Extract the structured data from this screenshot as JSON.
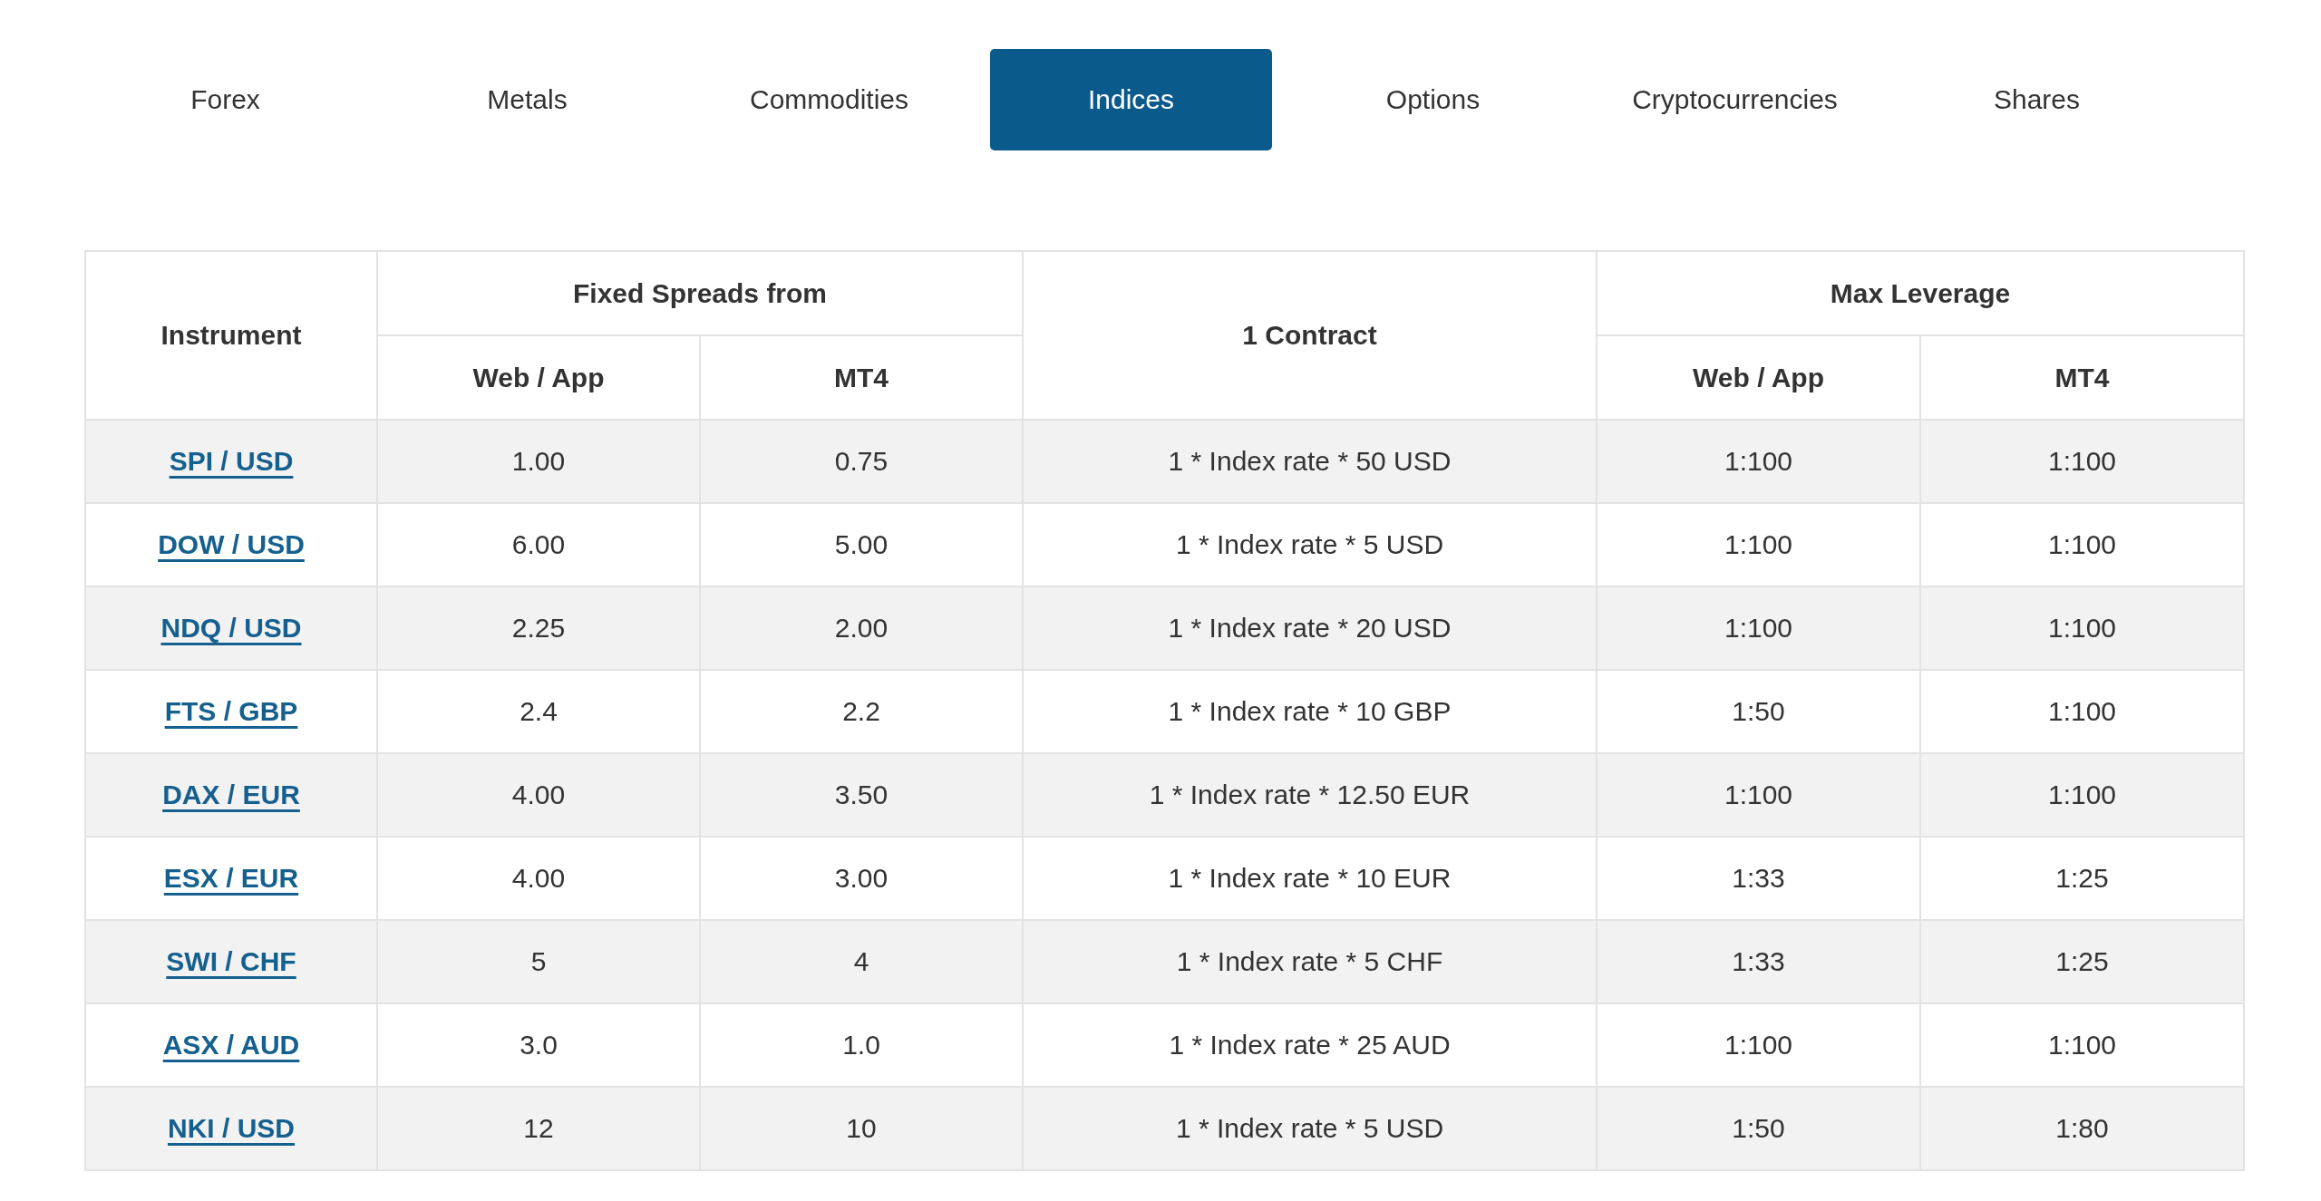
{
  "tabs": [
    {
      "label": "Forex",
      "selected": false
    },
    {
      "label": "Metals",
      "selected": false
    },
    {
      "label": "Commodities",
      "selected": false
    },
    {
      "label": "Indices",
      "selected": true
    },
    {
      "label": "Options",
      "selected": false
    },
    {
      "label": "Cryptocurrencies",
      "selected": false
    },
    {
      "label": "Shares",
      "selected": false
    }
  ],
  "table": {
    "header": {
      "instrument": "Instrument",
      "fixed_spreads": {
        "label": "Fixed Spreads from",
        "subcolumns": [
          "Web / App",
          "MT4"
        ]
      },
      "contract": "1 Contract",
      "max_leverage": {
        "label": "Max Leverage",
        "subcolumns": [
          "Web / App",
          "MT4"
        ]
      }
    },
    "rows": [
      {
        "instrument": "SPI / USD",
        "spread_web": "1.00",
        "spread_mt4": "0.75",
        "contract": "1 * Index rate * 50 USD",
        "leverage_web": "1:100",
        "leverage_mt4": "1:100"
      },
      {
        "instrument": "DOW / USD",
        "spread_web": "6.00",
        "spread_mt4": "5.00",
        "contract": "1 * Index rate * 5 USD",
        "leverage_web": "1:100",
        "leverage_mt4": "1:100"
      },
      {
        "instrument": "NDQ / USD",
        "spread_web": "2.25",
        "spread_mt4": "2.00",
        "contract": "1 * Index rate * 20 USD",
        "leverage_web": "1:100",
        "leverage_mt4": "1:100"
      },
      {
        "instrument": "FTS / GBP",
        "spread_web": "2.4",
        "spread_mt4": "2.2",
        "contract": "1 * Index rate * 10 GBP",
        "leverage_web": "1:50",
        "leverage_mt4": "1:100"
      },
      {
        "instrument": "DAX / EUR",
        "spread_web": "4.00",
        "spread_mt4": "3.50",
        "contract": "1 * Index rate * 12.50 EUR",
        "leverage_web": "1:100",
        "leverage_mt4": "1:100"
      },
      {
        "instrument": "ESX / EUR",
        "spread_web": "4.00",
        "spread_mt4": "3.00",
        "contract": "1 * Index rate * 10 EUR",
        "leverage_web": "1:33",
        "leverage_mt4": "1:25"
      },
      {
        "instrument": "SWI / CHF",
        "spread_web": "5",
        "spread_mt4": "4",
        "contract": "1 * Index rate * 5 CHF",
        "leverage_web": "1:33",
        "leverage_mt4": "1:25"
      },
      {
        "instrument": "ASX / AUD",
        "spread_web": "3.0",
        "spread_mt4": "1.0",
        "contract": "1 * Index rate * 25 AUD",
        "leverage_web": "1:100",
        "leverage_mt4": "1:100"
      },
      {
        "instrument": "NKI / USD",
        "spread_web": "12",
        "spread_mt4": "10",
        "contract": "1 * Index rate * 5 USD",
        "leverage_web": "1:50",
        "leverage_mt4": "1:80"
      }
    ]
  }
}
